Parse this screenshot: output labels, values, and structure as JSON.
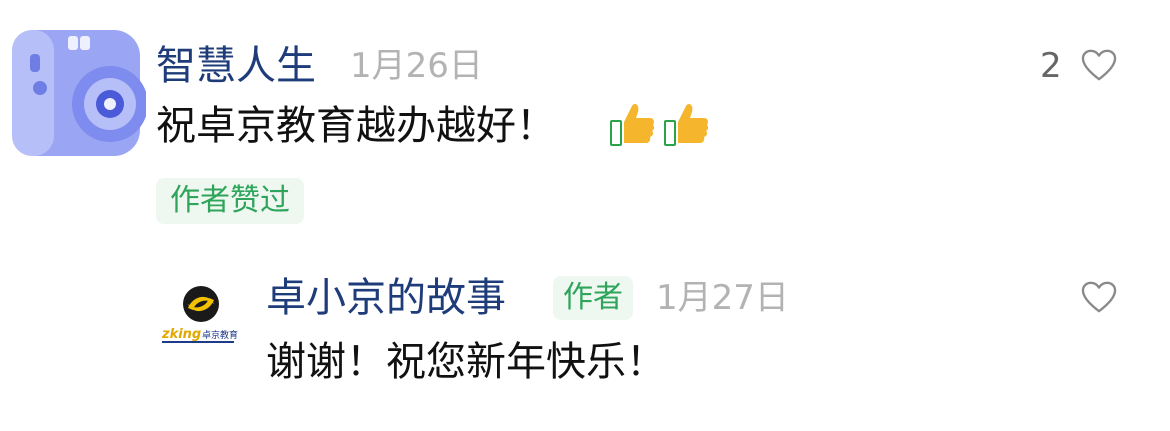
{
  "comment": {
    "username": "智慧人生",
    "date": "1月26日",
    "text": "祝卓京教育越办越好！",
    "emoji_icons": [
      "thumbs-up-icon",
      "thumbs-up-icon"
    ],
    "badge": "作者赞过",
    "like_count": "2",
    "like_icon": "heart-icon"
  },
  "reply": {
    "username": "卓小京的故事",
    "author_tag": "作者",
    "date": "1月27日",
    "text": "谢谢！祝您新年快乐！",
    "avatar_logo_text": "zking卓京教育",
    "like_icon": "heart-icon"
  },
  "colors": {
    "username": "#1f3c7a",
    "date": "#b3b3b3",
    "badge_bg": "#eef8f1",
    "badge_text": "#2ea55b",
    "avatar_main": "#8c9af0"
  }
}
